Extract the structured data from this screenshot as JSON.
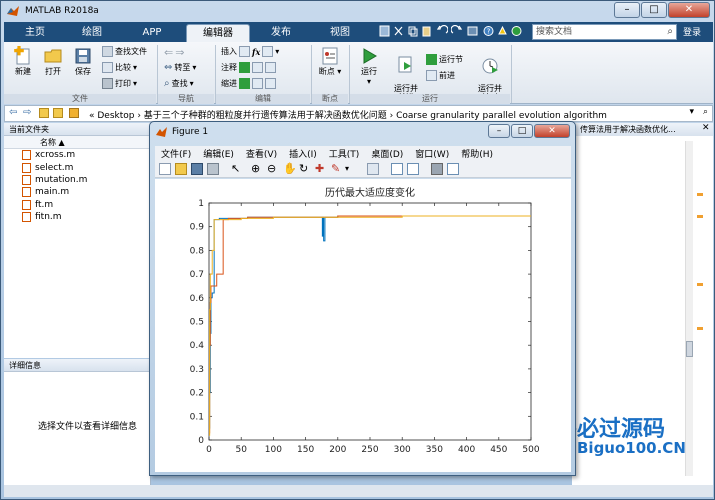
{
  "app": {
    "title": "MATLAB R2018a",
    "window_buttons": [
      "–",
      "□",
      "✕"
    ]
  },
  "ribbon_tabs": [
    {
      "label": "主页",
      "active": false
    },
    {
      "label": "绘图",
      "active": false
    },
    {
      "label": "APP",
      "active": false
    },
    {
      "label": "编辑器",
      "active": true
    },
    {
      "label": "发布",
      "active": false
    },
    {
      "label": "视图",
      "active": false
    }
  ],
  "search": {
    "placeholder": "搜索文档"
  },
  "login_label": "登录",
  "ribbon": {
    "file_group": {
      "label": "文件",
      "new": "新建",
      "open": "打开",
      "save": "保存",
      "find_files": "查找文件",
      "compare": "比较",
      "print": "打印"
    },
    "nav_group": {
      "label": "导航",
      "goto": "转至",
      "find": "查找"
    },
    "edit_group": {
      "label": "编辑",
      "insert": "插入",
      "comment": "注释",
      "indent": "缩进",
      "fx": "fx"
    },
    "breakpoints_group": {
      "label": "断点",
      "breakpoints": "断点"
    },
    "run_group": {
      "label": "运行",
      "run": "运行",
      "run_advance": "运行并\n前进",
      "run_section": "运行节",
      "advance": "前进",
      "run_time": "运行并\n计时"
    }
  },
  "address": {
    "path": "« Desktop  ›  基于三个子种群的粗粒度并行遗传算法用于解决函数优化问题  ›  Coarse granularity parallel evolution algorithm"
  },
  "current_folder": {
    "header": "当前文件夹",
    "column_name": "名称 ▲",
    "files": [
      "xcross.m",
      "select.m",
      "mutation.m",
      "main.m",
      "ft.m",
      "fitn.m"
    ]
  },
  "details": {
    "header": "详细信息",
    "message": "选择文件以查看详细信息"
  },
  "editor_right": {
    "header_snippet": "传算法用于解决函数优化..."
  },
  "figure": {
    "title": "Figure 1",
    "buttons": [
      "–",
      "□",
      "✕"
    ],
    "menu": [
      "文件(F)",
      "编辑(E)",
      "查看(V)",
      "插入(I)",
      "工具(T)",
      "桌面(D)",
      "窗口(W)",
      "帮助(H)"
    ]
  },
  "chart_data": {
    "type": "line",
    "title": "历代最大适应度变化",
    "xlabel": "",
    "ylabel": "",
    "xlim": [
      0,
      500
    ],
    "ylim": [
      0,
      1
    ],
    "xticks": [
      0,
      50,
      100,
      150,
      200,
      250,
      300,
      350,
      400,
      450,
      500
    ],
    "yticks": [
      0,
      0.1,
      0.2,
      0.3,
      0.4,
      0.5,
      0.6,
      0.7,
      0.8,
      0.9,
      1
    ],
    "grid": false,
    "series": [
      {
        "color": "#0072bd",
        "x": [
          0,
          1,
          2,
          3,
          5,
          8,
          12,
          16,
          20,
          30,
          60,
          120,
          175,
          176,
          177,
          178,
          180,
          200,
          300,
          400,
          500
        ],
        "y": [
          0.05,
          0.2,
          0.45,
          0.6,
          0.62,
          0.93,
          0.93,
          0.935,
          0.935,
          0.935,
          0.94,
          0.94,
          0.94,
          0.86,
          0.94,
          0.84,
          0.94,
          0.945,
          0.945,
          0.945,
          0.945
        ]
      },
      {
        "color": "#d95319",
        "x": [
          0,
          1,
          2,
          3,
          4,
          6,
          10,
          12,
          15,
          18,
          20,
          22,
          25,
          30,
          60,
          100,
          200,
          300,
          400,
          500
        ],
        "y": [
          0.03,
          0.4,
          0.58,
          0.65,
          0.65,
          0.65,
          0.65,
          0.7,
          0.7,
          0.7,
          0.7,
          0.93,
          0.93,
          0.935,
          0.94,
          0.94,
          0.945,
          0.945,
          0.945,
          0.945
        ]
      },
      {
        "color": "#edb120",
        "x": [
          0,
          1,
          2,
          3,
          4,
          5,
          8,
          12,
          20,
          50,
          100,
          200,
          300,
          400,
          500
        ],
        "y": [
          0.02,
          0.55,
          0.7,
          0.7,
          0.7,
          0.8,
          0.93,
          0.93,
          0.93,
          0.935,
          0.94,
          0.94,
          0.945,
          0.945,
          0.945
        ]
      }
    ]
  },
  "watermark": {
    "cn": "必过源码",
    "en": "Biguo100.CN"
  },
  "colors": {
    "tab_bar": "#1e4d7b",
    "ribbon_bg": "#e6ecf2",
    "run_green": "#2f9e3d"
  }
}
